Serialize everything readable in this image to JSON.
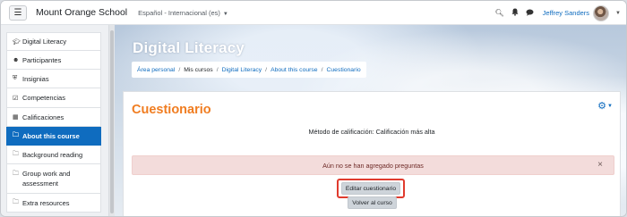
{
  "navbar": {
    "menu_icon": "hamburger-icon",
    "site_name": "Mount Orange School",
    "language": "Español - Internacional (es)",
    "icons": [
      "search-icon",
      "bell-icon",
      "chat-icon"
    ],
    "user_name": "Jeffrey Sanders"
  },
  "drawer": {
    "items": [
      {
        "label": "Digital Literacy",
        "icon": "graduation-cap-icon"
      },
      {
        "label": "Participantes",
        "icon": "users-icon"
      },
      {
        "label": "Insignias",
        "icon": "shield-icon"
      },
      {
        "label": "Competencias",
        "icon": "checkbox-icon"
      },
      {
        "label": "Calificaciones",
        "icon": "table-icon"
      },
      {
        "label": "About this course",
        "icon": "folder-icon",
        "active": true
      },
      {
        "label": "Background reading",
        "icon": "folder-icon"
      },
      {
        "label": "Group work and assessment",
        "icon": "folder-icon"
      },
      {
        "label": "Extra resources",
        "icon": "folder-icon"
      }
    ]
  },
  "header": {
    "course_title": "Digital Literacy",
    "breadcrumb": {
      "home": "Área personal",
      "my_courses": "Mis cursos",
      "course": "Digital Literacy",
      "section": "About this course",
      "activity": "Cuestionario"
    }
  },
  "main": {
    "heading": "Cuestionario",
    "settings_icon": "gear-icon",
    "grading_method": "Método de calificación: Calificación más alta",
    "alert_text": "Aún no se han agregado preguntas",
    "edit_button": "Editar cuestionario",
    "back_button": "Volver al curso"
  },
  "colors": {
    "accent": "#0f6cbf",
    "heading": "#f07d21",
    "alert_bg": "#f3dcdb",
    "highlight": "#e03b2e"
  }
}
